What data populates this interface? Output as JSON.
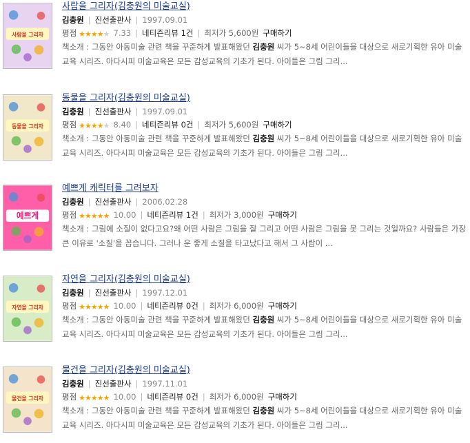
{
  "labels": {
    "rating": "평점",
    "intro": "책소개 :",
    "buy": "구매하기",
    "netizen_prefix": "네티즌리뷰",
    "lowest_prefix": "최저가"
  },
  "items": [
    {
      "title": "사람을 그리자(김충원의 미술교실)",
      "author": "김충원",
      "publisher": "진선출판사",
      "date": "1997.09.01",
      "rating": 3.5,
      "score": "7.33",
      "reviews": "1건",
      "price": "5,600원",
      "desc_pre": "그동안 아동미술 관련 책을 꾸준하게 발표해왔던",
      "desc_bold": "김충원",
      "desc_post": "씨가 5~8세 어린이들을 대상으로 새로기획한 유아 미술 교육 시리즈. 아다시피 미술교육은 모든 감성교육의 기초가 된다. 아이들은 그림 그리...",
      "cover_color": "#e8d4f0",
      "cover_text": "사람을 그리자"
    },
    {
      "title": "동물을 그리자(김충원의 미술교실)",
      "author": "김충원",
      "publisher": "진선출판사",
      "date": "1997.09.01",
      "rating": 4,
      "score": "8.40",
      "reviews": "0건",
      "price": "5,600원",
      "desc_pre": "그동안 아동미술 관련 책을 꾸준하게 발표해왔던",
      "desc_bold": "김충원",
      "desc_post": "씨가 5~8세 어린이들을 대상으로 새로기획한 유아 미술 교육 시리즈. 아다시피 미술교육은 모든 감성교육의 기초가 된다. 아이들은 그림 그리...",
      "cover_color": "#f0e8c8",
      "cover_text": "동물을 그리자"
    },
    {
      "title": "예쁘게 캐릭터를 그려보자",
      "author": "김충원",
      "publisher": "진선출판사",
      "date": "2006.02.28",
      "rating": 5,
      "score": "10.00",
      "reviews": "1건",
      "price": "3,000원",
      "desc_pre": "그림에 소질이 없다고요?왜 어떤 사람은 그림을 잘 그리고 어떤 사람은 그림을 못 그리는 것일까요? 사람들은 가장 큰 이유로 '소질'을 꼽습니다. 그러나 운 좋게 소질을 타고났다고 해서 그 사람이 ...",
      "desc_bold": "",
      "desc_post": "",
      "cover_color": "#ff5fa8",
      "cover_text": "예쁘게"
    },
    {
      "title": "자연을 그리자(김충원의 미술교실)",
      "author": "김충원",
      "publisher": "진선출판사",
      "date": "1997.12.01",
      "rating": 5,
      "score": "10.00",
      "reviews": "0건",
      "price": "6,000원",
      "desc_pre": "그동안 아동미술 관련 책을 꾸준하게 발표해왔던",
      "desc_bold": "김충원",
      "desc_post": "씨가 5~8세 어린이들을 대상으로 새로기획한 유아 미술 교육 시리즈. 아다시피 미술교육은 모든 감성교육의 기초가 된다. 아이들은 그림 그리...",
      "cover_color": "#d8ecc8",
      "cover_text": "자연을 그리자"
    },
    {
      "title": "물건을 그리자(김충원의 미술교실)",
      "author": "김충원",
      "publisher": "진선출판사",
      "date": "1997.11.01",
      "rating": 5,
      "score": "10.00",
      "reviews": "0건",
      "price": "6,000원",
      "desc_pre": "그동안 아동미술 관련 책을 꾸준하게 발표해왔던",
      "desc_bold": "김충원",
      "desc_post": "씨가 5~8세 어린이들을 대상으로 새로기획한 유아 미술 교육 시리즈. 아다시피 미술교육은 모든 감성교육의 기초가 된다. 아이들은 그림 그리...",
      "cover_color": "#f4e4cc",
      "cover_text": "물건을 그리자"
    }
  ]
}
